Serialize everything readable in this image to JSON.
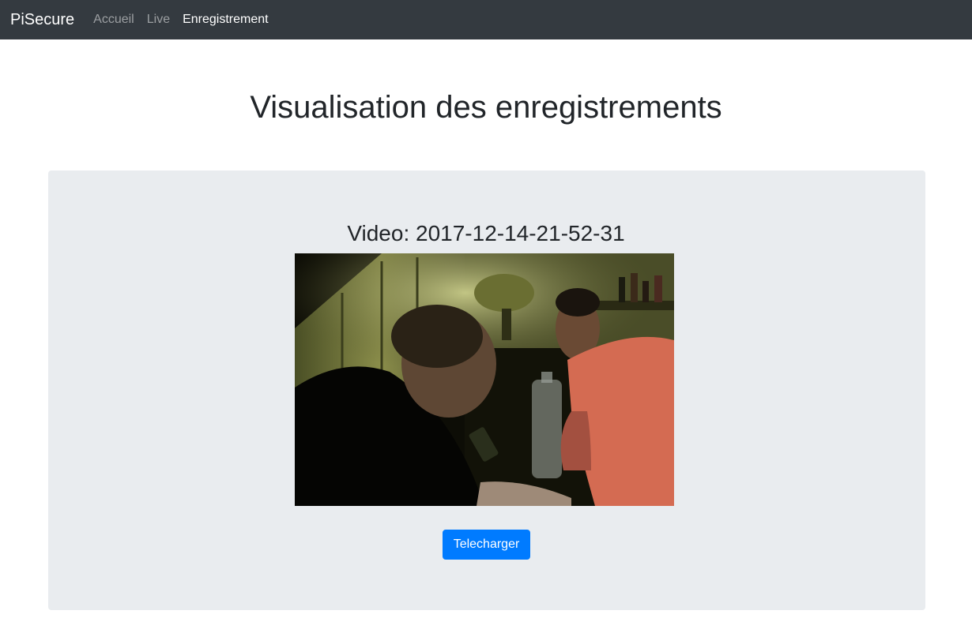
{
  "navbar": {
    "brand": "PiSecure",
    "links": [
      {
        "label": "Accueil",
        "active": false
      },
      {
        "label": "Live",
        "active": false
      },
      {
        "label": "Enregistrement",
        "active": true
      }
    ]
  },
  "page": {
    "title": "Visualisation des enregistrements"
  },
  "recording": {
    "title": "Video: 2017-12-14-21-52-31",
    "download_label": "Telecharger"
  },
  "colors": {
    "navbar_bg": "#343a40",
    "jumbotron_bg": "#e9ecef",
    "primary": "#007bff"
  }
}
